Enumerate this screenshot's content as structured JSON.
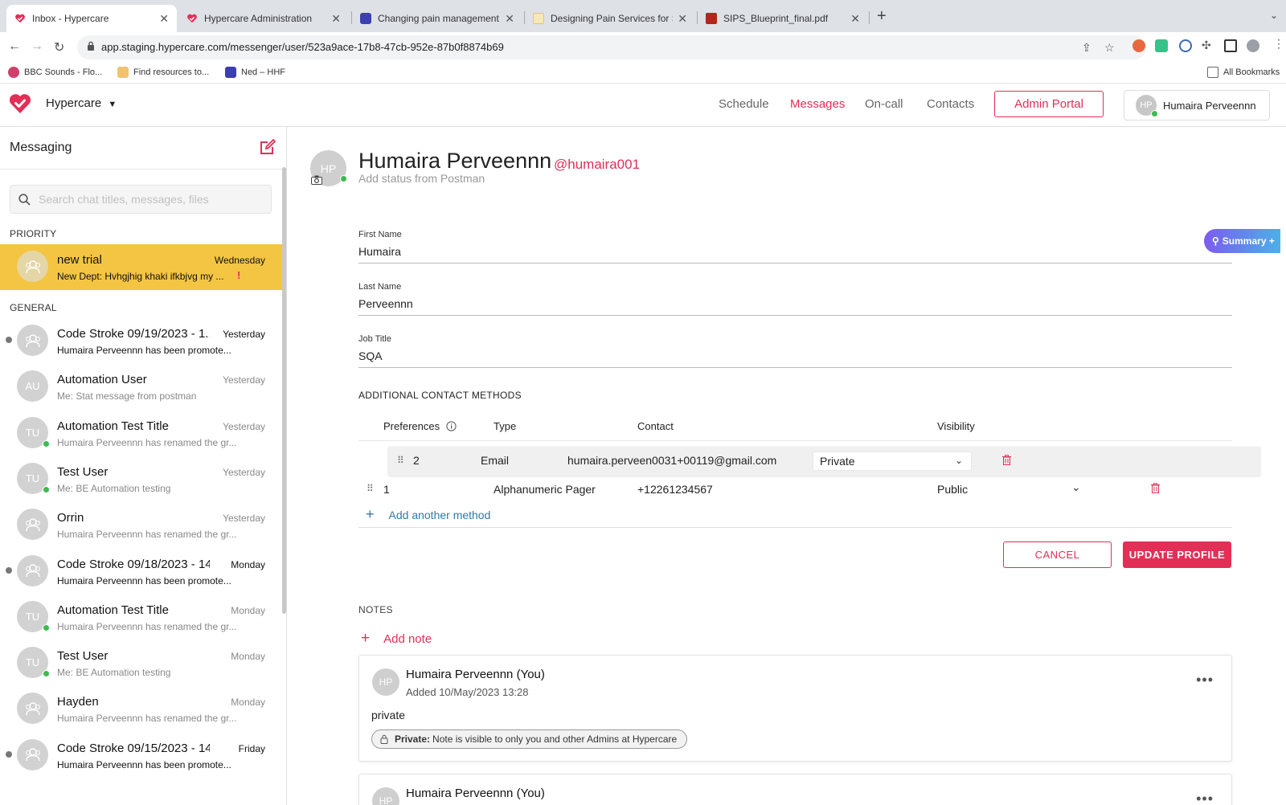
{
  "browser": {
    "tabs": [
      {
        "label": "Inbox - Hypercare",
        "icon": "hypercare-heart-icon"
      },
      {
        "label": "Hypercare Administration",
        "icon": "hypercare-heart-icon"
      },
      {
        "label": "Changing pain management fo",
        "icon": "blue-globe-icon"
      },
      {
        "label": "Designing Pain Services for Su",
        "icon": "doc-icon"
      },
      {
        "label": "SIPS_Blueprint_final.pdf",
        "icon": "pdf-icon"
      }
    ],
    "url": "app.staging.hypercare.com/messenger/user/523a9ace-17b8-47cb-952e-87b0f8874b69",
    "bookmarks": [
      "BBC Sounds - Flo...",
      "Find resources to...",
      "Ned – HHF"
    ],
    "all_bookmarks": "All Bookmarks"
  },
  "app_header": {
    "brand": "Hypercare",
    "nav": [
      "Schedule",
      "Messages",
      "On-call",
      "Contacts"
    ],
    "active_nav": "Messages",
    "admin_portal": "Admin Portal",
    "user_initials": "HP",
    "user_name": "Humaira Perveennn"
  },
  "sidebar": {
    "title": "Messaging",
    "search_placeholder": "Search chat titles, messages, files",
    "priority_label": "PRIORITY",
    "general_label": "GENERAL",
    "priority_chats": [
      {
        "title": "new trial",
        "time": "Wednesday",
        "preview": "New Dept: Hvhgjhig khaki ifkbjvg my ...",
        "avatar": "group"
      }
    ],
    "general_chats": [
      {
        "title": "Code Stroke 09/19/2023 - 1...",
        "time": "Yesterday",
        "preview": "Humaira Perveennn has been promote...",
        "avatar": "group",
        "unread": true
      },
      {
        "title": "Automation User",
        "time": "Yesterday",
        "preview": "Me: Stat message from postman",
        "avatar": "AU",
        "unread": false
      },
      {
        "title": "Automation Test Title",
        "time": "Yesterday",
        "preview": "Humaira Perveennn has renamed the gr...",
        "avatar": "TU",
        "unread": false,
        "online": true
      },
      {
        "title": "Test User",
        "time": "Yesterday",
        "preview": "Me: BE Automation testing",
        "avatar": "TU",
        "unread": false,
        "online": true
      },
      {
        "title": "Orrin",
        "time": "Yesterday",
        "preview": "Humaira Perveennn has renamed the gr...",
        "avatar": "group",
        "unread": false
      },
      {
        "title": "Code Stroke 09/18/2023 - 14:...",
        "time": "Monday",
        "preview": "Humaira Perveennn has been promote...",
        "avatar": "group",
        "unread": true
      },
      {
        "title": "Automation Test Title",
        "time": "Monday",
        "preview": "Humaira Perveennn has renamed the gr...",
        "avatar": "TU",
        "unread": false,
        "online": true
      },
      {
        "title": "Test User",
        "time": "Monday",
        "preview": "Me: BE Automation testing",
        "avatar": "TU",
        "unread": false,
        "online": true
      },
      {
        "title": "Hayden",
        "time": "Monday",
        "preview": "Humaira Perveennn has renamed the gr...",
        "avatar": "group",
        "unread": false
      },
      {
        "title": "Code Stroke 09/15/2023 - 14:0...",
        "time": "Friday",
        "preview": "Humaira Perveennn has been promote...",
        "avatar": "group",
        "unread": true
      }
    ]
  },
  "profile": {
    "initials": "HP",
    "name": "Humaira Perveennn",
    "handle": "@humaira001",
    "status": "Add status from Postman",
    "first_name_label": "First Name",
    "first_name": "Humaira",
    "last_name_label": "Last Name",
    "last_name": "Perveennn",
    "job_title_label": "Job Title",
    "job_title": "SQA"
  },
  "contact_methods": {
    "heading": "ADDITIONAL CONTACT METHODS",
    "columns": [
      "Preferences",
      "Type",
      "Contact",
      "Visibility"
    ],
    "rows": [
      {
        "pref": "2",
        "type": "Email",
        "contact": "humaira.perveen0031+00119@gmail.com",
        "visibility": "Private"
      },
      {
        "pref": "1",
        "type": "Alphanumeric Pager",
        "contact": "+12261234567",
        "visibility": "Public"
      }
    ],
    "add_label": "Add another method",
    "cancel": "CANCEL",
    "update": "UPDATE PROFILE"
  },
  "notes": {
    "heading": "NOTES",
    "add_label": "Add note",
    "items": [
      {
        "initials": "HP",
        "author": "Humaira Perveennn (You)",
        "date": "Added 10/May/2023 13:28",
        "body": "private",
        "badge_strong": "Private:",
        "badge_text": "Note is visible to only you and other Admins at Hypercare"
      },
      {
        "initials": "HP",
        "author": "Humaira Perveennn (You)"
      }
    ]
  },
  "summary_button": "Summary +",
  "colors": {
    "brand": "#e32e56",
    "priority": "#f4c542",
    "link": "#2e7aa8",
    "online": "#3dbb50"
  }
}
